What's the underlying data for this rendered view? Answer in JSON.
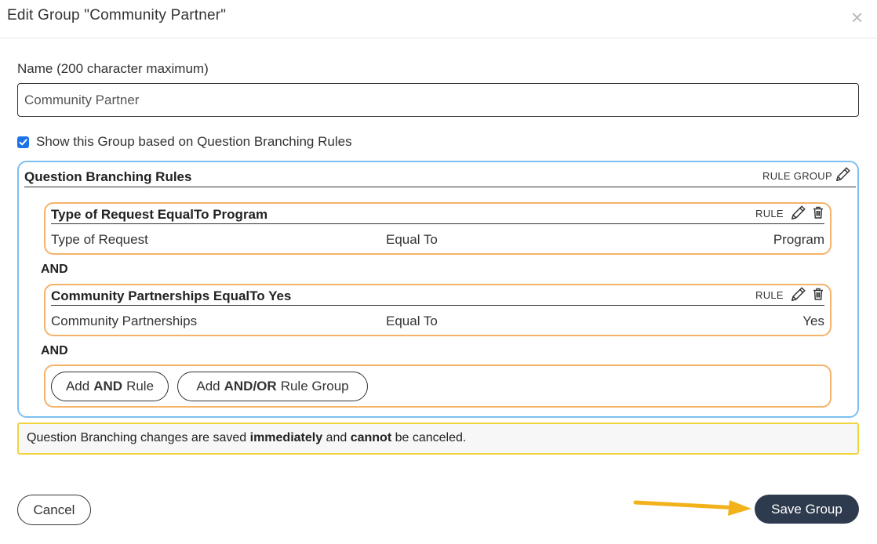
{
  "dialog": {
    "title": "Edit Group \"Community Partner\"",
    "close_glyph": "×"
  },
  "form": {
    "name_label": "Name (200 character maximum)",
    "name_value": "Community Partner",
    "show_checkbox_label": "Show this Group based on Question Branching Rules",
    "show_checked": true
  },
  "branching": {
    "title": "Question Branching Rules",
    "rule_group_label": "RULE GROUP",
    "rules": [
      {
        "title": "Type of Request EqualTo Program",
        "label": "RULE",
        "field": "Type of Request",
        "operator": "Equal To",
        "value": "Program"
      },
      {
        "title": "Community Partnerships EqualTo Yes",
        "label": "RULE",
        "field": "Community Partnerships",
        "operator": "Equal To",
        "value": "Yes"
      }
    ],
    "connectors": [
      "AND",
      "AND"
    ],
    "add_rule": {
      "prefix": "Add",
      "bold": "AND",
      "suffix": "Rule"
    },
    "add_group": {
      "prefix": "Add",
      "bold": "AND/OR",
      "suffix": "Rule Group"
    }
  },
  "notice": {
    "part1": "Question Branching changes are saved ",
    "bold1": "immediately",
    "part2": " and ",
    "bold2": "cannot",
    "part3": " be canceled."
  },
  "footer": {
    "cancel_label": "Cancel",
    "save_label": "Save Group"
  },
  "colors": {
    "rule_group_border": "#7cbff0",
    "rule_border": "#f5b26b",
    "notice_border": "#f0d440",
    "save_button": "#2e3a4e",
    "checkbox": "#1a73e8",
    "arrow": "#f2b21c"
  },
  "icons": {
    "close": "close-icon",
    "edit": "pencil-icon",
    "delete": "trash-icon",
    "check": "check-icon",
    "annotation": "arrow-right-icon"
  }
}
